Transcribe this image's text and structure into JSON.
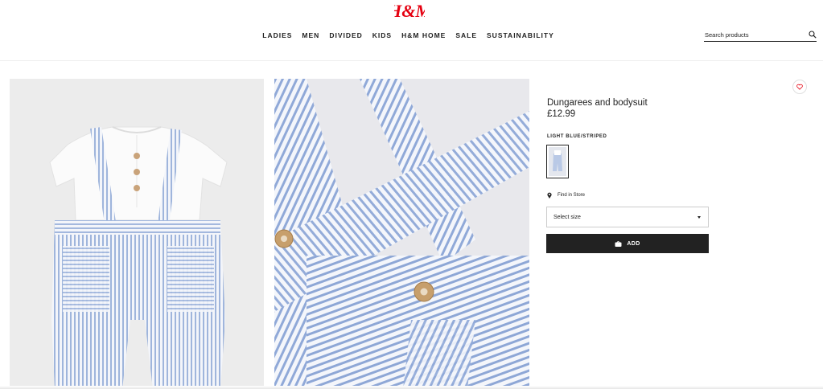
{
  "header": {
    "logo_text": "H&M",
    "nav": [
      "LADIES",
      "MEN",
      "DIVIDED",
      "KIDS",
      "H&M HOME",
      "SALE",
      "SUSTAINABILITY"
    ],
    "search": {
      "placeholder": "Search products",
      "icon": "search-icon"
    }
  },
  "gallery": {
    "images": [
      {
        "description_icon": "product-photo-front"
      },
      {
        "description_icon": "product-photo-detail"
      }
    ]
  },
  "product": {
    "title": "Dungarees and bodysuit",
    "price": "£12.99",
    "color_label": "LIGHT BLUE/STRIPED",
    "find_in_store": "Find in Store",
    "size_select": "Select size",
    "add_label": "ADD",
    "wishlist_icon": "heart-icon",
    "accent_color": "#e50010"
  }
}
